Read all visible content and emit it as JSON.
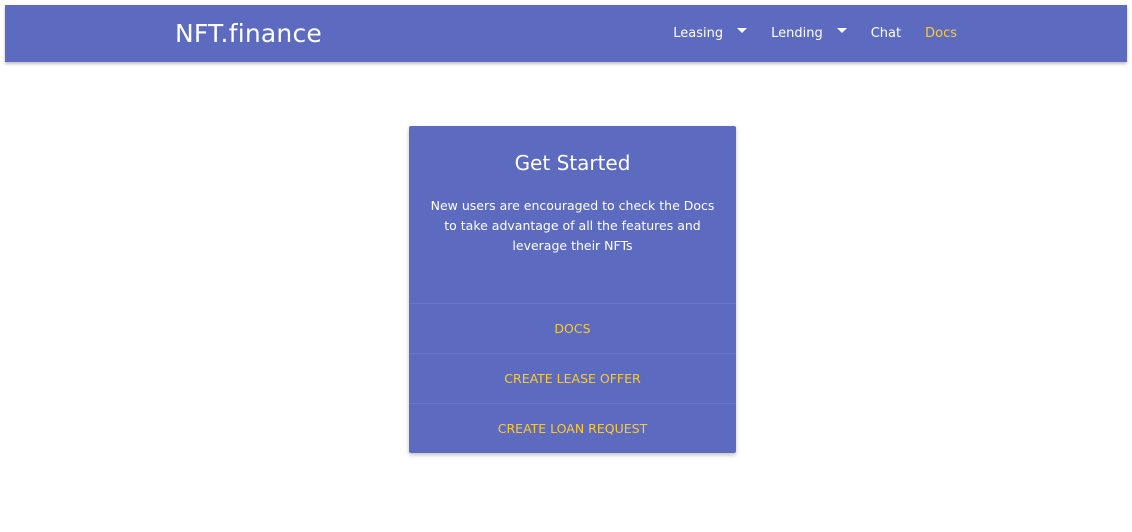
{
  "brand": "NFT.finance",
  "nav": {
    "leasing": "Leasing",
    "lending": "Lending",
    "chat": "Chat",
    "docs": "Docs"
  },
  "card": {
    "title": "Get Started",
    "text": "New users are encouraged to check the Docs to take advantage of all the features and leverage their NFTs",
    "actions": {
      "docs": "DOCS",
      "lease": "CREATE LEASE OFFER",
      "loan": "CREATE LOAN REQUEST"
    }
  },
  "colors": {
    "primary": "#5c6bc0",
    "accent": "#ffca28",
    "text": "#ffffff"
  }
}
